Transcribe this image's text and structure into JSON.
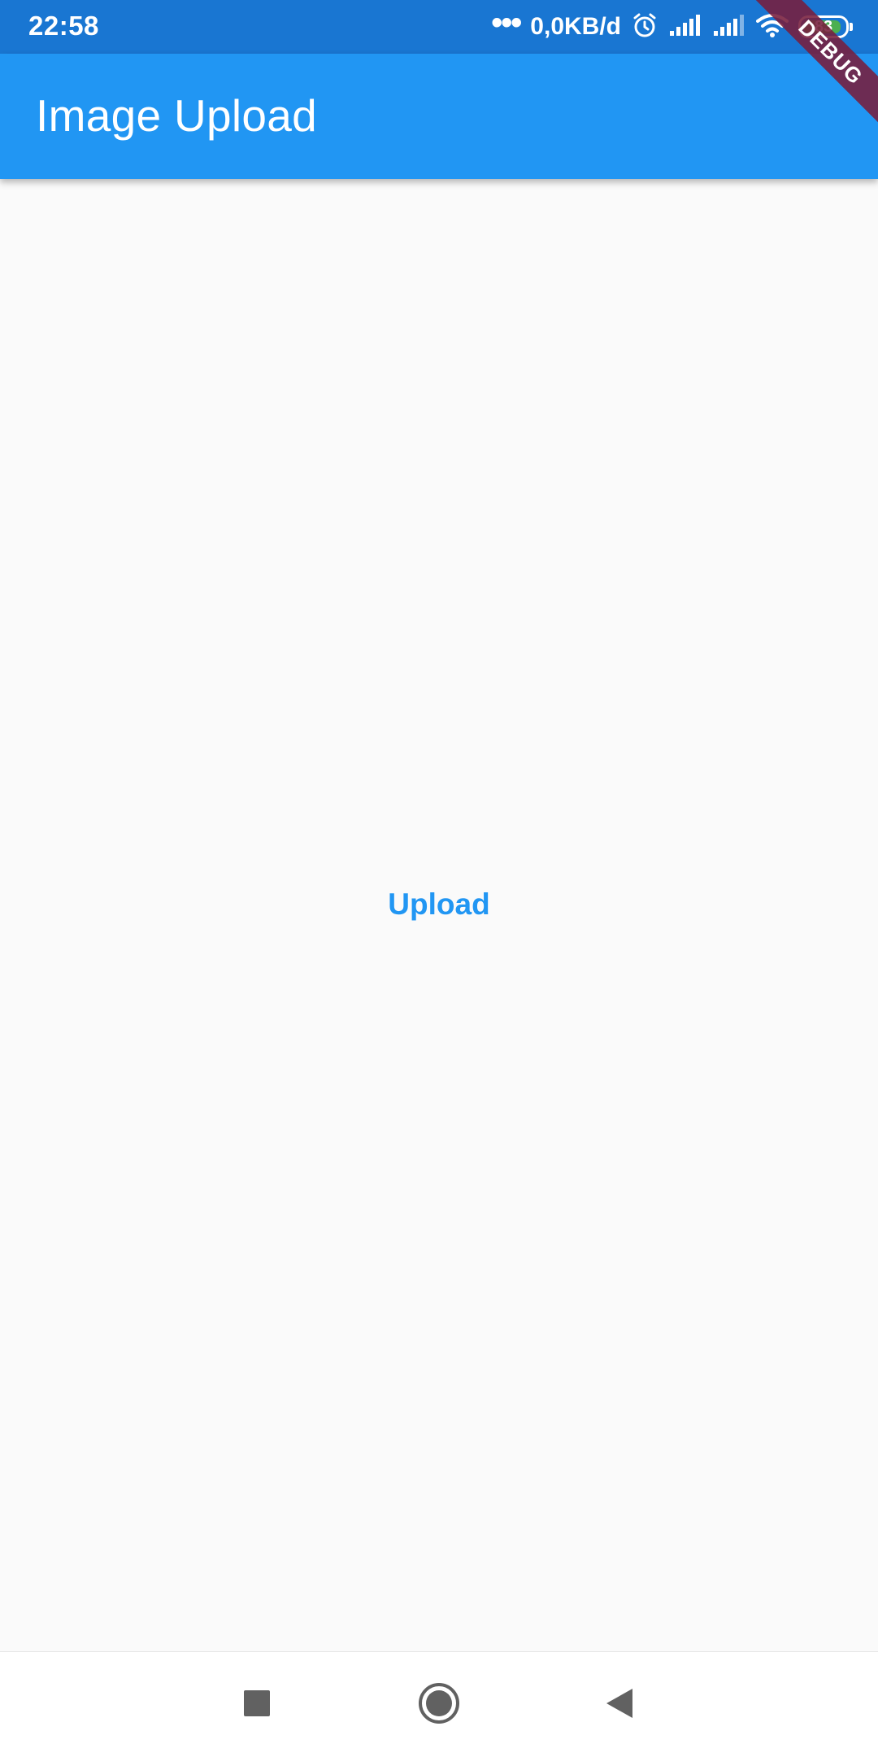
{
  "status_bar": {
    "time": "22:58",
    "dots": "•••",
    "speed": "0,0KB/d",
    "battery_level": "83",
    "icons": [
      "alarm-icon",
      "signal-icon",
      "signal-icon",
      "wifi-icon",
      "battery-icon"
    ],
    "background_color": "#1976d2"
  },
  "app_bar": {
    "title": "Image Upload",
    "background_color": "#2196f3"
  },
  "debug_banner": {
    "label": "DEBUG"
  },
  "main": {
    "upload_label": "Upload",
    "accent_color": "#2196f3"
  },
  "nav_bar": {
    "icons": [
      "recent-apps-icon",
      "home-icon",
      "back-icon"
    ]
  }
}
